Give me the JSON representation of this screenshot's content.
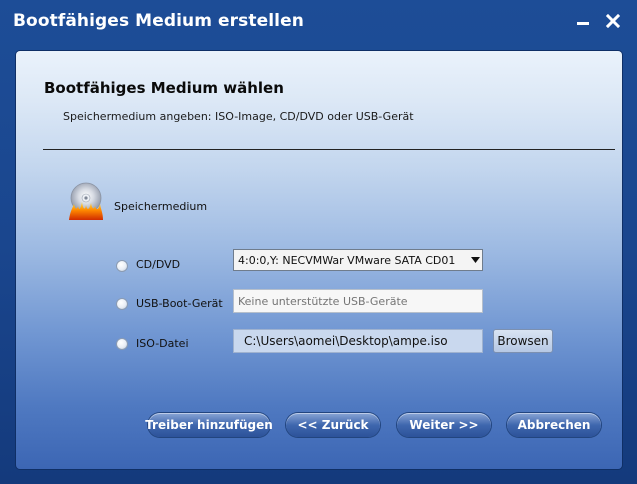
{
  "window": {
    "title": "Bootfähiges Medium erstellen"
  },
  "header": {
    "heading": "Bootfähiges Medium wählen",
    "subheading": "Speichermedium angeben: ISO-Image, CD/DVD oder USB-Gerät"
  },
  "media": {
    "label": "Speichermedium"
  },
  "options": {
    "cd": {
      "label": "CD/DVD",
      "selected_value": "4:0:0,Y: NECVMWar VMware SATA CD01"
    },
    "usb": {
      "label": "USB-Boot-Gerät",
      "placeholder": "Keine unterstützte USB-Geräte"
    },
    "iso": {
      "label": "ISO-Datei",
      "value": "C:\\Users\\aomei\\Desktop\\ampe.iso",
      "browse_label": "Browsen"
    }
  },
  "footer": {
    "add_driver": "Treiber hinzufügen",
    "back": "<< Zurück",
    "next": "Weiter >>",
    "cancel": "Abbrechen"
  }
}
